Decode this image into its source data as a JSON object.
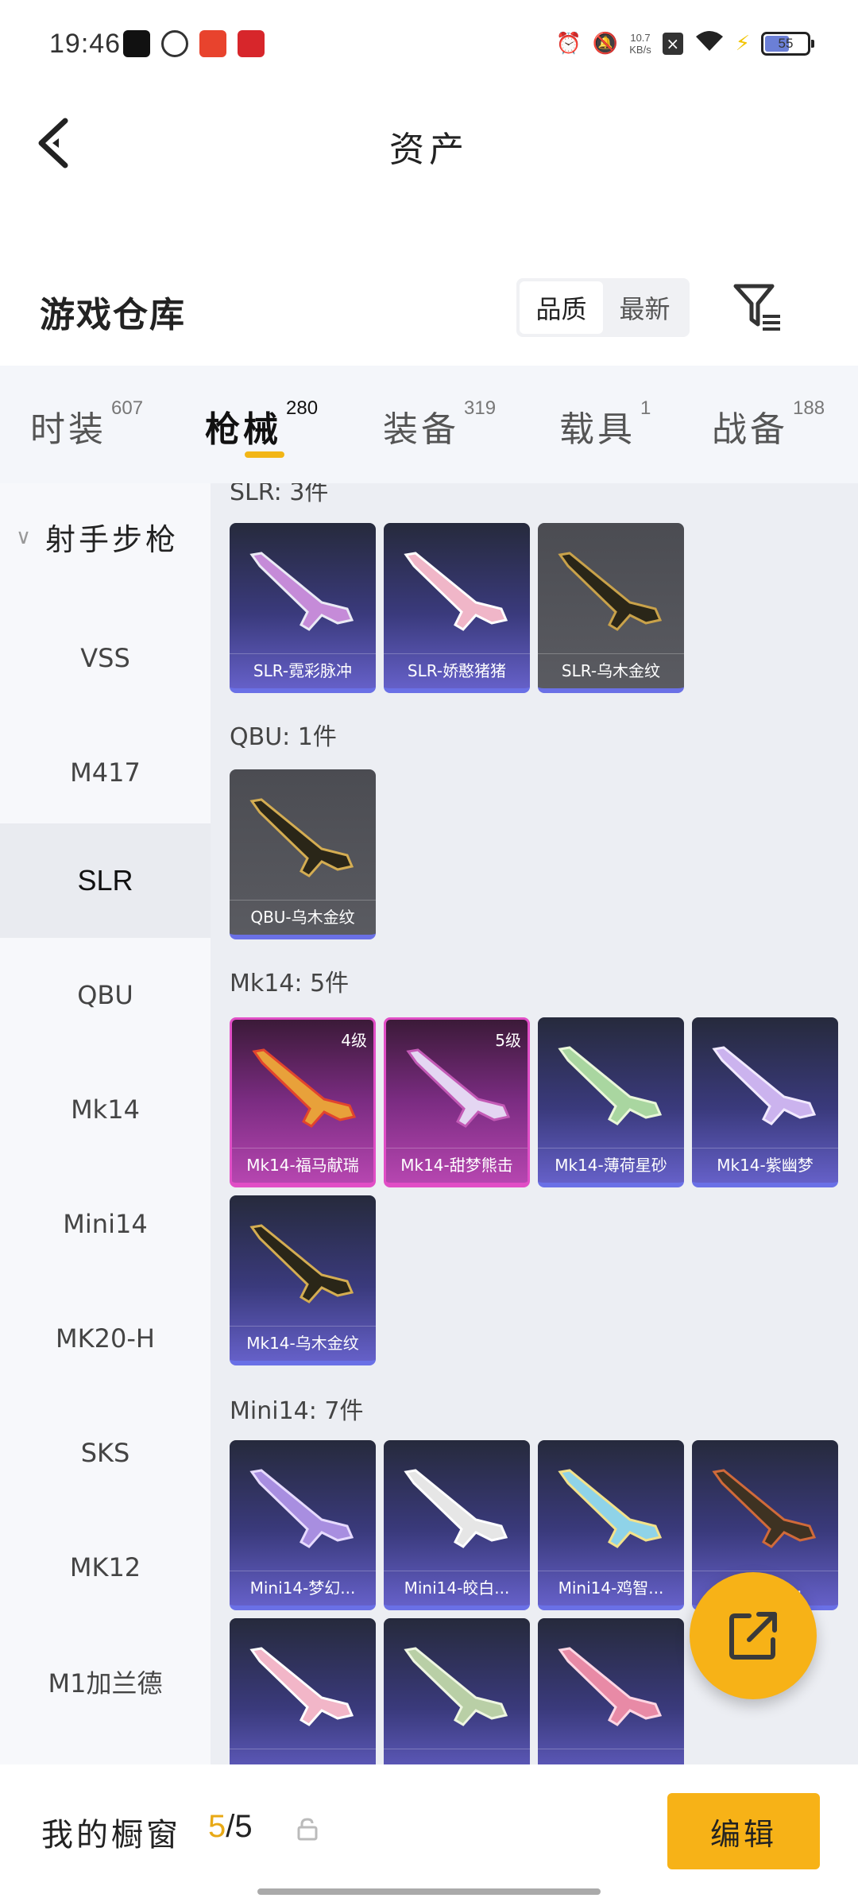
{
  "status_bar": {
    "time": "19:46",
    "net_speed_value": "10.7",
    "net_speed_unit": "KB/s",
    "battery": "55"
  },
  "header": {
    "title": "资产"
  },
  "section": {
    "title": "游戏仓库",
    "sort_options": [
      "品质",
      "最新"
    ]
  },
  "tabs": [
    {
      "label": "时装",
      "count": "607"
    },
    {
      "label": "枪械",
      "count": "280"
    },
    {
      "label": "装备",
      "count": "319"
    },
    {
      "label": "载具",
      "count": "1"
    },
    {
      "label": "战备",
      "count": "188"
    }
  ],
  "sidebar": {
    "category": "射手步枪",
    "items": [
      "VSS",
      "M417",
      "SLR",
      "QBU",
      "Mk14",
      "Mini14",
      "MK20-H",
      "SKS",
      "MK12",
      "M1加兰德"
    ]
  },
  "groups": [
    {
      "label": "SLR: 3件",
      "items": [
        {
          "name": "SLR-霓彩脉冲",
          "level": ""
        },
        {
          "name": "SLR-娇憨猪猪",
          "level": ""
        },
        {
          "name": "SLR-乌木金纹",
          "level": ""
        }
      ]
    },
    {
      "label": "QBU: 1件",
      "items": [
        {
          "name": "QBU-乌木金纹",
          "level": ""
        }
      ]
    },
    {
      "label": "Mk14: 5件",
      "items": [
        {
          "name": "Mk14-福马献瑞",
          "level": "4级"
        },
        {
          "name": "Mk14-甜梦熊击",
          "level": "5级"
        },
        {
          "name": "Mk14-薄荷星砂",
          "level": ""
        },
        {
          "name": "Mk14-紫幽梦",
          "level": ""
        },
        {
          "name": "Mk14-乌木金纹",
          "level": ""
        }
      ]
    },
    {
      "label": "Mini14: 7件",
      "items": [
        {
          "name": "Mini14-梦幻...",
          "level": ""
        },
        {
          "name": "Mini14-皎白...",
          "level": ""
        },
        {
          "name": "Mini14-鸡智...",
          "level": ""
        },
        {
          "name": "Mini14-...",
          "level": ""
        },
        {
          "name": "",
          "level": ""
        },
        {
          "name": "",
          "level": ""
        },
        {
          "name": "",
          "level": ""
        }
      ]
    }
  ],
  "bottom_bar": {
    "label": "我的橱窗",
    "current": "5",
    "sep_total": "/5",
    "edit": "编辑"
  },
  "colors": {
    "accent": "#f7b217",
    "card_purple": "#3a3a7c",
    "card_pink": "#b646b0",
    "card_gray": "#55565c"
  }
}
